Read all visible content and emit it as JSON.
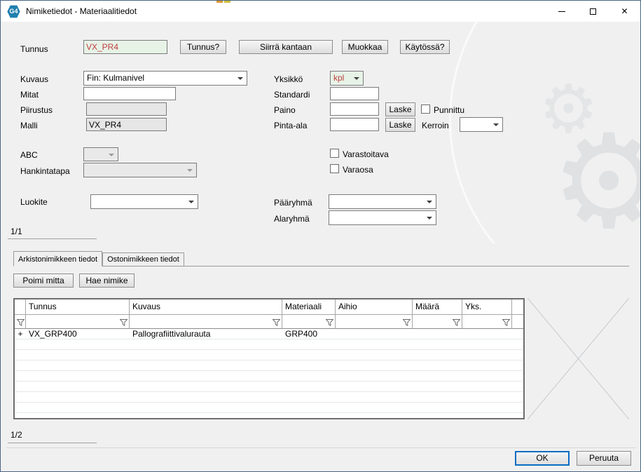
{
  "window": {
    "title": "Nimiketiedot - Materiaalitiedot",
    "app_icon": "G4",
    "controls": {
      "minimize": "—",
      "maximize": "□",
      "close": "✕"
    }
  },
  "form": {
    "fields": {
      "tunnus": {
        "label": "Tunnus",
        "value": "VX_PR4"
      },
      "kuvaus": {
        "label": "Kuvaus",
        "value": "Fin: Kulmanivel"
      },
      "yksikko": {
        "label": "Yksikkö",
        "value": "kpl"
      },
      "mitat": {
        "label": "Mitat",
        "value": ""
      },
      "standardi": {
        "label": "Standardi",
        "value": ""
      },
      "piirustus": {
        "label": "Piirustus",
        "value": ""
      },
      "paino": {
        "label": "Paino",
        "value": ""
      },
      "malli": {
        "label": "Malli",
        "value": "VX_PR4"
      },
      "pinta_ala": {
        "label": "Pinta-ala",
        "value": ""
      },
      "kerroin": {
        "label": "Kerroin",
        "value": ""
      },
      "abc": {
        "label": "ABC",
        "value": ""
      },
      "hankintatapa": {
        "label": "Hankintatapa",
        "value": ""
      },
      "luokite": {
        "label": "Luokite",
        "value": ""
      },
      "paaryhma": {
        "label": "Pääryhmä",
        "value": ""
      },
      "alaryhma": {
        "label": "Alaryhmä",
        "value": ""
      }
    },
    "buttons": {
      "tunnus_kysely": "Tunnus?",
      "siirra_kantaan": "Siirrä kantaan",
      "muokkaa": "Muokkaa",
      "kaytossa": "Käytössä?",
      "laske_paino": "Laske",
      "laske_pinta_ala": "Laske"
    },
    "checkboxes": {
      "punnittu": {
        "label": "Punnittu",
        "checked": false
      },
      "varastoitava": {
        "label": "Varastoitava",
        "checked": false
      },
      "varaosa": {
        "label": "Varaosa",
        "checked": false
      }
    },
    "page_indicator": "1/1"
  },
  "tabs": [
    {
      "label": "Arkistonimikkeen tiedot",
      "active": true
    },
    {
      "label": "Ostonimikkeen tiedot",
      "active": false
    }
  ],
  "grid_toolbar": {
    "poimi_mitta": "Poimi mitta",
    "hae_nimike": "Hae nimike"
  },
  "grid": {
    "columns": [
      "Tunnus",
      "Kuvaus",
      "Materiaali",
      "Aihio",
      "Määrä",
      "Yks."
    ],
    "rows": [
      {
        "marker": "+",
        "tunnus": "VX_GRP400",
        "kuvaus": "Pallografiittivalurauta",
        "materiaali": "GRP400",
        "aihio": "",
        "maara": "",
        "yks": ""
      }
    ],
    "page_indicator": "1/2"
  },
  "footer": {
    "ok": "OK",
    "peruuta": "Peruuta"
  },
  "colors": {
    "value_text_red": "#bf3f3f",
    "field_green_bg": "#e7f3e7",
    "focus_blue": "#0a6cc4",
    "app_icon_blue": "#1f7fae"
  }
}
